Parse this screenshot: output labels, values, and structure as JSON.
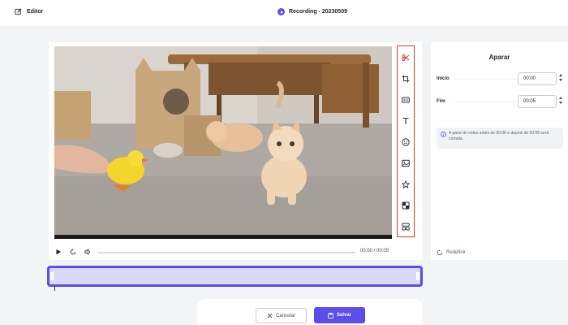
{
  "header": {
    "editor_label": "Editor",
    "recording_title": "Recording - 20230509"
  },
  "video": {
    "scene": "kittens and chick toy",
    "time_display": "00:00 / 00:05"
  },
  "toolbar": {
    "tools": [
      "scissors-icon",
      "crop-icon",
      "caption-icon",
      "text-icon",
      "emoji-icon",
      "image-icon",
      "sticker-icon",
      "filter-icon",
      "layout-icon"
    ],
    "highlight_color": "#e23434"
  },
  "trim_panel": {
    "title": "Aparar",
    "start_label": "Início",
    "start_value": "00:00",
    "end_label": "Fim",
    "end_value": "00:05",
    "info_text": "A parte do vídeo antes de 00:00 e depois de 00:05 será cortada.",
    "reset_label": "Redefinir"
  },
  "footer": {
    "cancel_label": "Cancelar",
    "save_label": "Salvar"
  },
  "colors": {
    "accent": "#5b4de8",
    "timeline_fill": "#dcd8fb"
  }
}
